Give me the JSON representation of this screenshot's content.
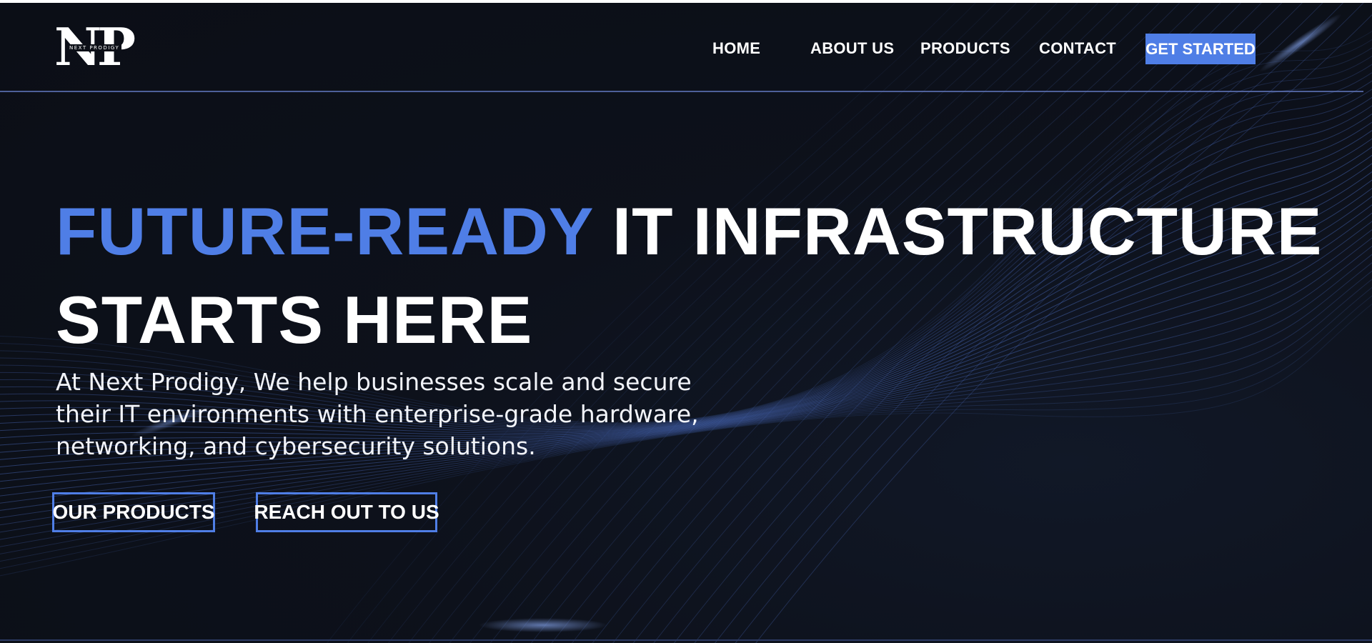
{
  "brand": {
    "logo_letters": "NP",
    "logo_subtext": "NEXT PRODIGY"
  },
  "nav": {
    "items": [
      {
        "label": "HOME"
      },
      {
        "label": "ABOUT US"
      },
      {
        "label": "PRODUCTS"
      },
      {
        "label": "CONTACT"
      }
    ],
    "cta_label": "GET STARTED"
  },
  "hero": {
    "title_accent": "FUTURE-READY",
    "title_rest": "IT INFRASTRUCTURE",
    "title_line2": "STARTS HERE",
    "subtitle": "At Next Prodigy, We help businesses scale and secure their IT environments with enterprise-grade hardware, networking, and cybersecurity solutions.",
    "primary_button": "OUR PRODUCTS",
    "secondary_button": "REACH OUT TO US"
  },
  "colors": {
    "background": "#0c0f17",
    "accent": "#4f7ee6",
    "text": "#ffffff",
    "wave_lines": "#3d5ca8"
  }
}
